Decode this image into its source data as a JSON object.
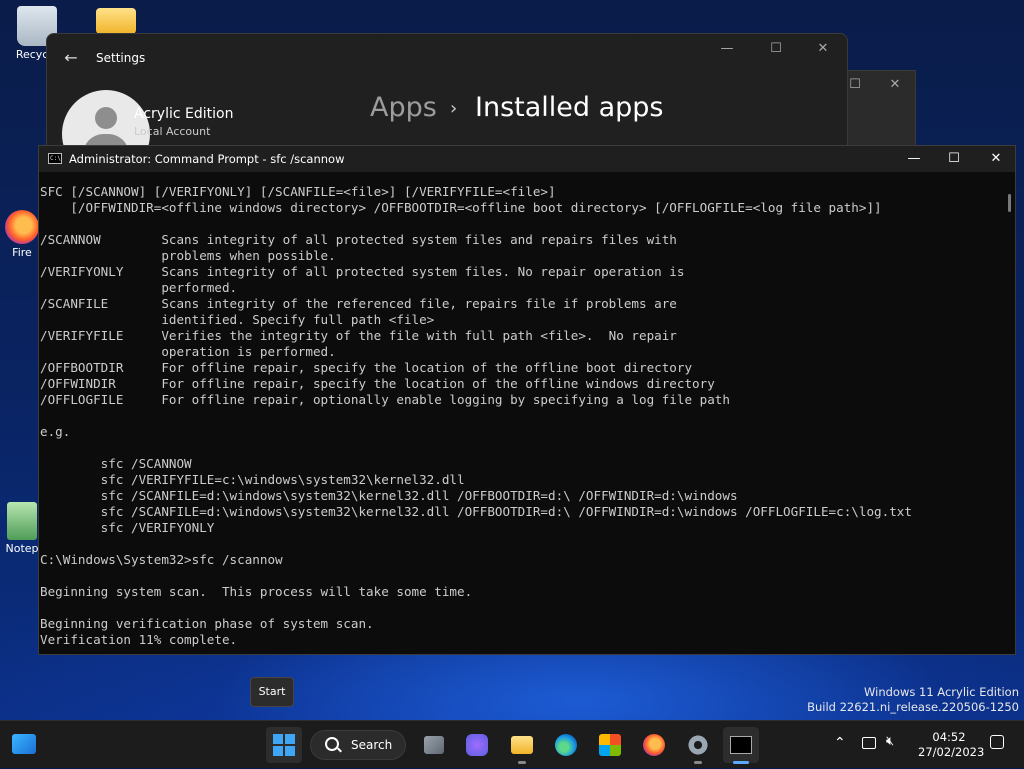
{
  "desktop": {
    "icons": [
      {
        "label": "Recycle"
      },
      {
        "label": ""
      },
      {
        "label": "Fire"
      },
      {
        "label": "Notep"
      }
    ]
  },
  "settings": {
    "app_title": "Settings",
    "user_name": "Acrylic Edition",
    "account_type": "Local Account",
    "breadcrumb_parent": "Apps",
    "breadcrumb_separator": "›",
    "breadcrumb_current": "Installed apps"
  },
  "cmd": {
    "title": "Administrator: Command Prompt - sfc  /scannow",
    "lines": [
      "SFC [/SCANNOW] [/VERIFYONLY] [/SCANFILE=<file>] [/VERIFYFILE=<file>]",
      "    [/OFFWINDIR=<offline windows directory> /OFFBOOTDIR=<offline boot directory> [/OFFLOGFILE=<log file path>]]",
      "",
      "/SCANNOW        Scans integrity of all protected system files and repairs files with",
      "                problems when possible.",
      "/VERIFYONLY     Scans integrity of all protected system files. No repair operation is",
      "                performed.",
      "/SCANFILE       Scans integrity of the referenced file, repairs file if problems are",
      "                identified. Specify full path <file>",
      "/VERIFYFILE     Verifies the integrity of the file with full path <file>.  No repair",
      "                operation is performed.",
      "/OFFBOOTDIR     For offline repair, specify the location of the offline boot directory",
      "/OFFWINDIR      For offline repair, specify the location of the offline windows directory",
      "/OFFLOGFILE     For offline repair, optionally enable logging by specifying a log file path",
      "",
      "e.g.",
      "",
      "        sfc /SCANNOW",
      "        sfc /VERIFYFILE=c:\\windows\\system32\\kernel32.dll",
      "        sfc /SCANFILE=d:\\windows\\system32\\kernel32.dll /OFFBOOTDIR=d:\\ /OFFWINDIR=d:\\windows",
      "        sfc /SCANFILE=d:\\windows\\system32\\kernel32.dll /OFFBOOTDIR=d:\\ /OFFWINDIR=d:\\windows /OFFLOGFILE=c:\\log.txt",
      "        sfc /VERIFYONLY",
      "",
      "C:\\Windows\\System32>sfc /scannow",
      "",
      "Beginning system scan.  This process will take some time.",
      "",
      "Beginning verification phase of system scan.",
      "Verification 11% complete."
    ]
  },
  "tooltip": {
    "start": "Start"
  },
  "watermark": {
    "edition": "Windows 11 Acrylic Edition",
    "build": "Build 22621.ni_release.220506-1250"
  },
  "taskbar": {
    "search_label": "Search",
    "time": "04:52",
    "date": "27/02/2023"
  },
  "colors": {
    "accent": "#3fa5f5",
    "console_bg": "#0c0c0c",
    "console_text": "#cccccc",
    "taskbar_bg": "#1c1c1c"
  }
}
